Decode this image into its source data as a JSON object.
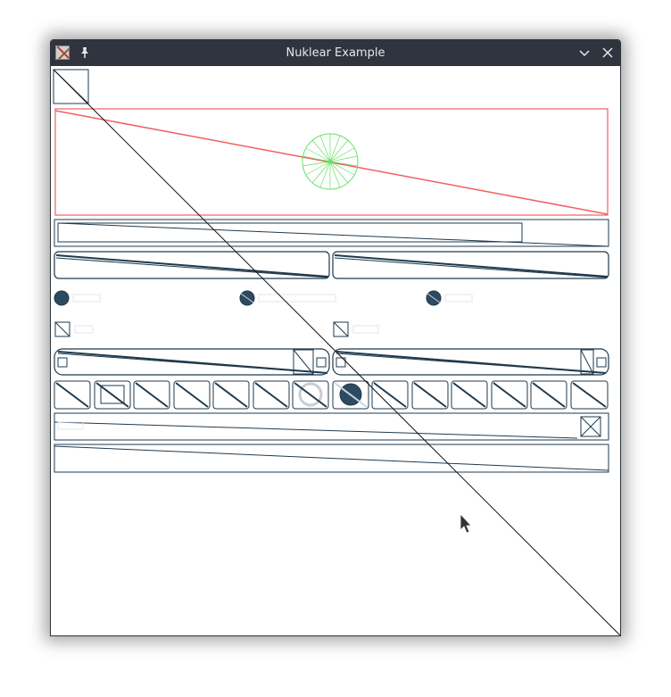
{
  "window": {
    "title": "Nuklear Example",
    "title_bar_color": "#2f343f",
    "icons": {
      "app": "nuklear-app-icon",
      "pin": "pin-icon",
      "minimize": "chevron-down-icon",
      "close": "close-icon"
    },
    "glyphs": {
      "pin": "📌",
      "minimize": "⌄",
      "close": "✕"
    }
  },
  "colors": {
    "widget_stroke": "#1f3a4d",
    "chart_stroke": "#f06060",
    "circle_stroke": "#66e066",
    "diagonal": "#111111"
  },
  "widgets": {
    "radio_count": 3,
    "checkbox_count": 2,
    "icon_button_count": 14
  }
}
